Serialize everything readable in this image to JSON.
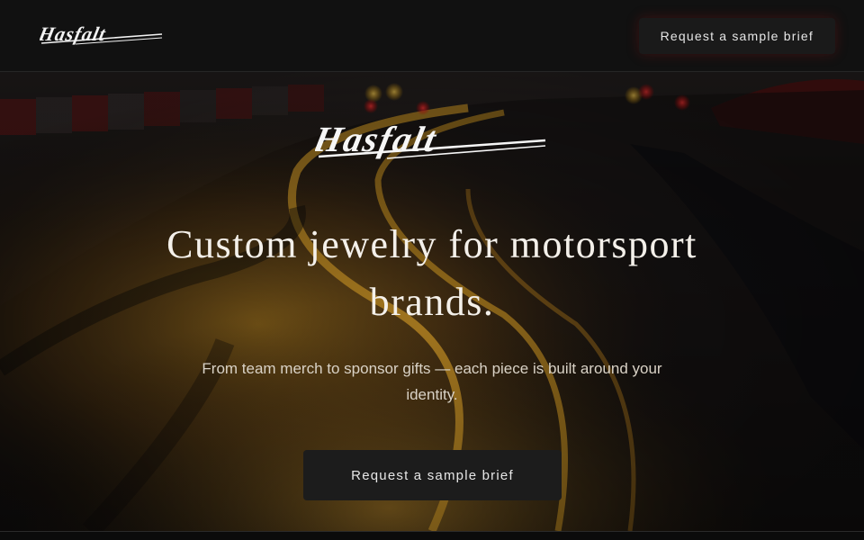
{
  "header": {
    "logo_text": "Hasfalt",
    "cta_label": "Request a sample brief"
  },
  "hero": {
    "logo_text": "Hasfalt",
    "headline": "Custom jewelry for motorsport brands.",
    "subheadline": "From team merch to sponsor gifts — each piece is built around your identity.",
    "cta_label": "Request a sample brief",
    "background_image": "wet-race-track-at-night"
  },
  "colors": {
    "background": "#111111",
    "button": "#1c1c1c",
    "text": "#f4f0ea",
    "accent_glow": "#aa1414"
  }
}
